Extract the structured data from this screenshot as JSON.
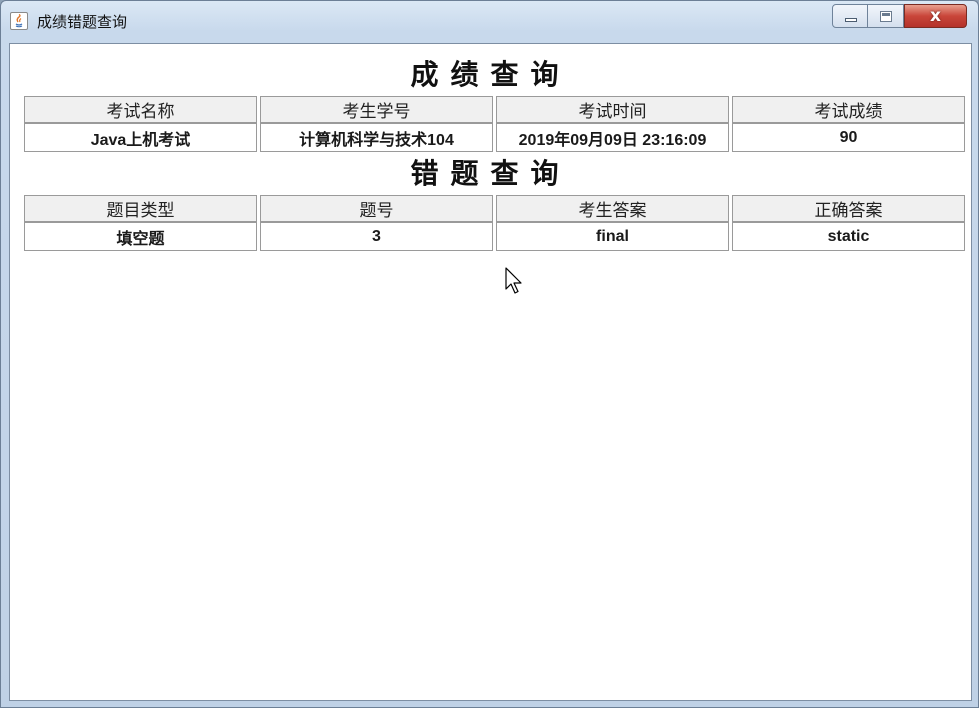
{
  "window": {
    "title": "成绩错题查询",
    "app_icon": "java-icon",
    "controls": {
      "minimize_icon": "minimize-icon",
      "maximize_icon": "maximize-icon",
      "close_label": "x"
    }
  },
  "score_section": {
    "heading": "成绩查询",
    "columns": [
      "考试名称",
      "考生学号",
      "考试时间",
      "考试成绩"
    ],
    "rows": [
      [
        "Java上机考试",
        "计算机科学与技术104",
        "2019年09月09日  23:16:09",
        "90"
      ]
    ]
  },
  "mistake_section": {
    "heading": "错题查询",
    "columns": [
      "题目类型",
      "题号",
      "考生答案",
      "正确答案"
    ],
    "rows": [
      [
        "填空题",
        "3",
        "final",
        "static"
      ]
    ]
  },
  "colors": {
    "header_bg": "#f0f0f0",
    "close_button": "#c9463a",
    "titlebar": "#c8d9ec"
  }
}
